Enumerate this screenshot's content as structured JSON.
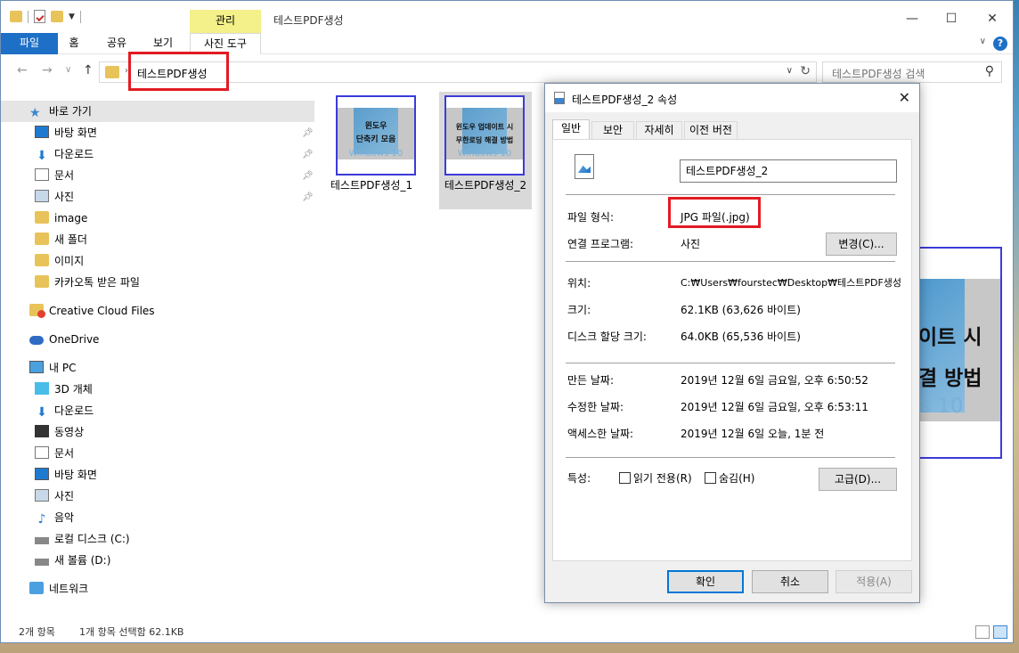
{
  "window": {
    "title": "테스트PDF생성",
    "manage_tab": "관리",
    "minimize": "—",
    "maximize": "☐",
    "close": "✕"
  },
  "ribbon": {
    "tabs": [
      "파일",
      "홈",
      "공유",
      "보기",
      "사진 도구"
    ]
  },
  "address": {
    "crumb": "테스트PDF생성",
    "search_placeholder": "테스트PDF생성 검색"
  },
  "sidebar": {
    "quick_access": "바로 가기",
    "quick_items": [
      "바탕 화면",
      "다운로드",
      "문서",
      "사진",
      "image",
      "새 폴더",
      "이미지",
      "카카오톡 받은 파일"
    ],
    "creative_cloud": "Creative Cloud Files",
    "onedrive": "OneDrive",
    "this_pc": "내 PC",
    "pc_items": [
      "3D 개체",
      "다운로드",
      "동영상",
      "문서",
      "바탕 화면",
      "사진",
      "음악",
      "로컬 디스크 (C:)",
      "새 볼륨 (D:)"
    ],
    "network": "네트워크"
  },
  "files": [
    {
      "name": "테스트PDF생성_1",
      "thumb_line1": "윈도우",
      "thumb_line2": "단축키 모음",
      "thumb_sub": "Windows 10"
    },
    {
      "name": "테스트PDF생성_2",
      "thumb_line1": "윈도우 업데이트 시",
      "thumb_line2": "무한로딩 해결 방법",
      "thumb_sub": "Windows 10"
    }
  ],
  "preview": {
    "line1": "이트 시",
    "line2": "결 방법",
    "line3": "s 10"
  },
  "status": {
    "count": "2개 항목",
    "selected": "1개 항목 선택함 62.1KB"
  },
  "dialog": {
    "title": "테스트PDF생성_2 속성",
    "tabs": [
      "일반",
      "보안",
      "자세히",
      "이전 버전"
    ],
    "filename": "테스트PDF생성_2",
    "rows": {
      "file_type_label": "파일 형식:",
      "file_type": "JPG 파일(.jpg)",
      "opens_with_label": "연결 프로그램:",
      "opens_with": "사진",
      "change_button": "변경(C)...",
      "location_label": "위치:",
      "location": "C:₩Users₩fourstec₩Desktop₩테스트PDF생성",
      "size_label": "크기:",
      "size": "62.1KB (63,626 바이트)",
      "disk_size_label": "디스크 할당 크기:",
      "disk_size": "64.0KB (65,536 바이트)",
      "created_label": "만든 날짜:",
      "created": "2019년 12월 6일 금요일, 오후 6:50:52",
      "modified_label": "수정한 날짜:",
      "modified": "2019년 12월 6일 금요일, 오후 6:53:11",
      "accessed_label": "액세스한 날짜:",
      "accessed": "2019년 12월 6일 오늘, 1분 전",
      "attributes_label": "특성:",
      "readonly": "읽기 전용(R)",
      "hidden": "숨김(H)",
      "advanced_button": "고급(D)..."
    },
    "ok": "확인",
    "cancel": "취소",
    "apply": "적용(A)"
  },
  "colors": {
    "accent": "#1e6fc6",
    "highlight_box": "#e21b23",
    "manage_tab": "#f4f08a"
  }
}
